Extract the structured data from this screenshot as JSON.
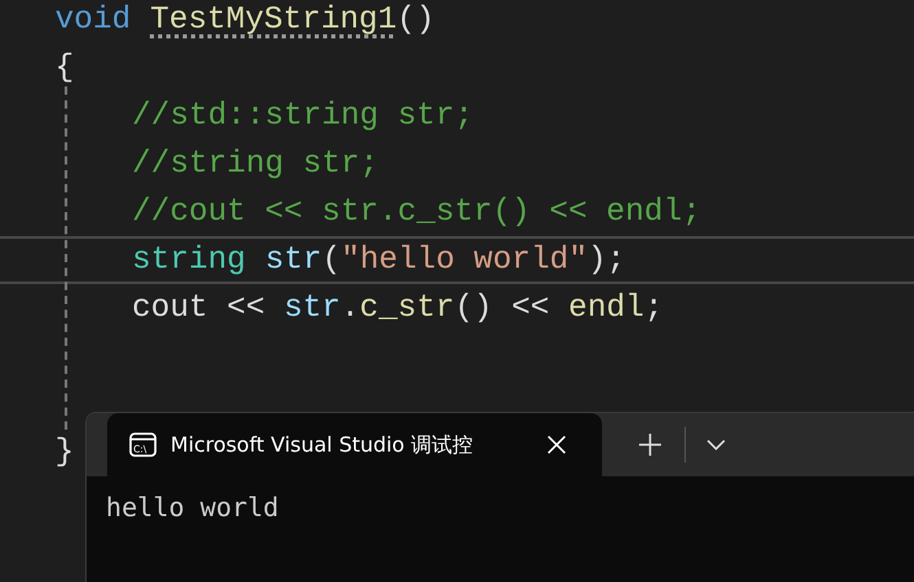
{
  "editor": {
    "lines": [
      {
        "current": false,
        "indented": false,
        "tokens": [
          {
            "text": "void",
            "kind": "keyword"
          },
          {
            "text": "TestMyString1",
            "kind": "function",
            "hint": true,
            "space_before": true
          },
          {
            "text": "()",
            "kind": "plain"
          }
        ]
      },
      {
        "current": false,
        "indented": false,
        "tokens": [
          {
            "text": "{",
            "kind": "plain"
          }
        ]
      },
      {
        "current": false,
        "indented": true,
        "tokens": [
          {
            "text": "//std::string str;",
            "kind": "comment"
          }
        ]
      },
      {
        "current": false,
        "indented": true,
        "tokens": [
          {
            "text": "//string str;",
            "kind": "comment"
          }
        ]
      },
      {
        "current": false,
        "indented": true,
        "tokens": [
          {
            "text": "//cout << str.c_str() << endl;",
            "kind": "comment"
          }
        ]
      },
      {
        "current": true,
        "indented": true,
        "tokens": [
          {
            "text": "string",
            "kind": "type"
          },
          {
            "text": "str",
            "kind": "variable",
            "space_before": true
          },
          {
            "text": "(",
            "kind": "plain"
          },
          {
            "text": "\"hello world\"",
            "kind": "string"
          },
          {
            "text": ");",
            "kind": "plain"
          }
        ]
      },
      {
        "current": false,
        "indented": true,
        "tokens": [
          {
            "text": "cout",
            "kind": "plain"
          },
          {
            "text": " << ",
            "kind": "plain"
          },
          {
            "text": "str",
            "kind": "variable"
          },
          {
            "text": ".",
            "kind": "plain"
          },
          {
            "text": "c_str",
            "kind": "function"
          },
          {
            "text": "() << ",
            "kind": "plain"
          },
          {
            "text": "endl",
            "kind": "function"
          },
          {
            "text": ";",
            "kind": "plain"
          }
        ]
      },
      {
        "current": false
      },
      {
        "current": false
      },
      {
        "current": false,
        "indented": false,
        "tokens": [
          {
            "text": "}",
            "kind": "plain"
          }
        ]
      }
    ]
  },
  "terminal": {
    "tab": {
      "title": "Microsoft Visual Studio 调试控",
      "icon_text": "C:\\",
      "selected": true
    },
    "output": [
      "hello world"
    ]
  }
}
